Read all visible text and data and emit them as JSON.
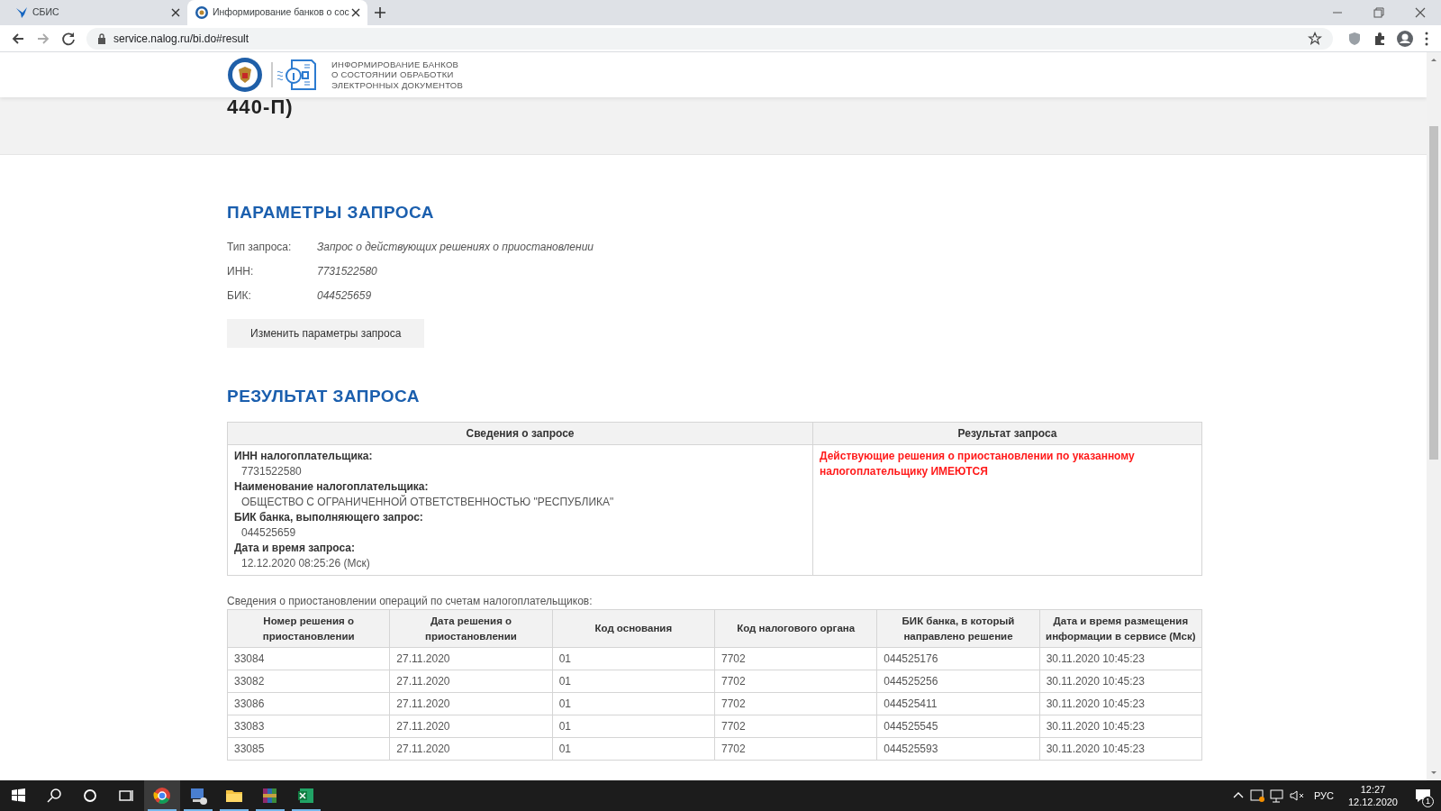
{
  "browser": {
    "tabs": [
      {
        "title": "СБИС",
        "selected": false,
        "kind": "bird"
      },
      {
        "title": "Информирование банков о сос",
        "selected": true,
        "kind": "emblem"
      }
    ],
    "url": "service.nalog.ru/bi.do#result"
  },
  "site_header": {
    "lines": [
      "ИНФОРМИРОВАНИЕ БАНКОВ",
      "О СОСТОЯНИИ ОБРАБОТКИ",
      "ЭЛЕКТРОННЫХ ДОКУМЕНТОВ"
    ],
    "title_fragment": "440-П)"
  },
  "params": {
    "heading": "ПАРАМЕТРЫ ЗАПРОСА",
    "rows": [
      {
        "label": "Тип запроса:",
        "value": "Запрос о действующих решениях о приостановлении"
      },
      {
        "label": "ИНН:",
        "value": "7731522580"
      },
      {
        "label": "БИК:",
        "value": "044525659"
      }
    ],
    "button": "Изменить параметры запроса"
  },
  "result": {
    "heading": "РЕЗУЛЬТАТ ЗАПРОСА",
    "columns": [
      "Сведения о запросе",
      "Результат запроса"
    ],
    "fields": [
      {
        "label": "ИНН налогоплательщика:",
        "value": "7731522580"
      },
      {
        "label": "Наименование налогоплательщика:",
        "value": "ОБЩЕСТВО С ОГРАНИЧЕННОЙ ОТВЕТСТВЕННОСТЬЮ \"РЕСПУБЛИКА\""
      },
      {
        "label": "БИК банка, выполняющего запрос:",
        "value": "044525659"
      },
      {
        "label": "Дата и время запроса:",
        "value": "12.12.2020 08:25:26 (Мск)"
      }
    ],
    "verdict": "Действующие решения о приостановлении по указанному налогоплательщику ИМЕЮТСЯ"
  },
  "suspensions": {
    "caption": "Сведения о приостановлении операций по счетам налогоплательщиков:",
    "columns": [
      "Номер решения о приостановлении",
      "Дата решения о приостановлении",
      "Код основания",
      "Код налогового органа",
      "БИК банка, в который направлено решение",
      "Дата и время размещения информации в сервисе (Мск)"
    ],
    "rows": [
      [
        "33084",
        "27.11.2020",
        "01",
        "7702",
        "044525176",
        "30.11.2020 10:45:23"
      ],
      [
        "33082",
        "27.11.2020",
        "01",
        "7702",
        "044525256",
        "30.11.2020 10:45:23"
      ],
      [
        "33086",
        "27.11.2020",
        "01",
        "7702",
        "044525411",
        "30.11.2020 10:45:23"
      ],
      [
        "33083",
        "27.11.2020",
        "01",
        "7702",
        "044525545",
        "30.11.2020 10:45:23"
      ],
      [
        "33085",
        "27.11.2020",
        "01",
        "7702",
        "044525593",
        "30.11.2020 10:45:23"
      ]
    ]
  },
  "taskbar": {
    "apps": [
      {
        "kind": "chrome",
        "selected": true
      },
      {
        "kind": "remote",
        "selected": false
      },
      {
        "kind": "folder",
        "selected": false
      },
      {
        "kind": "archive",
        "selected": false
      },
      {
        "kind": "excel",
        "selected": false
      }
    ],
    "language": "РУС",
    "time": "12:27",
    "date": "12.12.2020",
    "notifications": "1"
  }
}
